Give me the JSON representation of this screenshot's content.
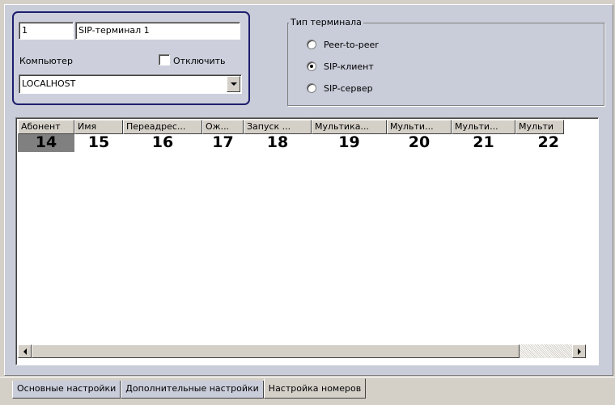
{
  "terminal": {
    "number": "1",
    "name": "SIP-терминал 1",
    "computer_label": "Компьютер",
    "disable_label": "Отключить",
    "disable_checked": false,
    "computer_value": "LOCALHOST"
  },
  "terminal_type": {
    "title": "Тип терминала",
    "options": [
      {
        "label": "Peer-to-peer",
        "selected": false
      },
      {
        "label": "SIP-клиент",
        "selected": true
      },
      {
        "label": "SIP-сервер",
        "selected": false
      }
    ]
  },
  "grid": {
    "columns": [
      "Абонент",
      "Имя",
      "Переадрес...",
      "Ож...",
      "Запуск ...",
      "Мультика...",
      "Мульти...",
      "Мульти...",
      "Мульти"
    ],
    "row": [
      "14",
      "15",
      "16",
      "17",
      "18",
      "19",
      "20",
      "21",
      "22"
    ]
  },
  "tabs": [
    "Основные настройки",
    "Дополнительные настройки",
    "Настройка номеров"
  ],
  "active_tab": "Настройка номеров"
}
